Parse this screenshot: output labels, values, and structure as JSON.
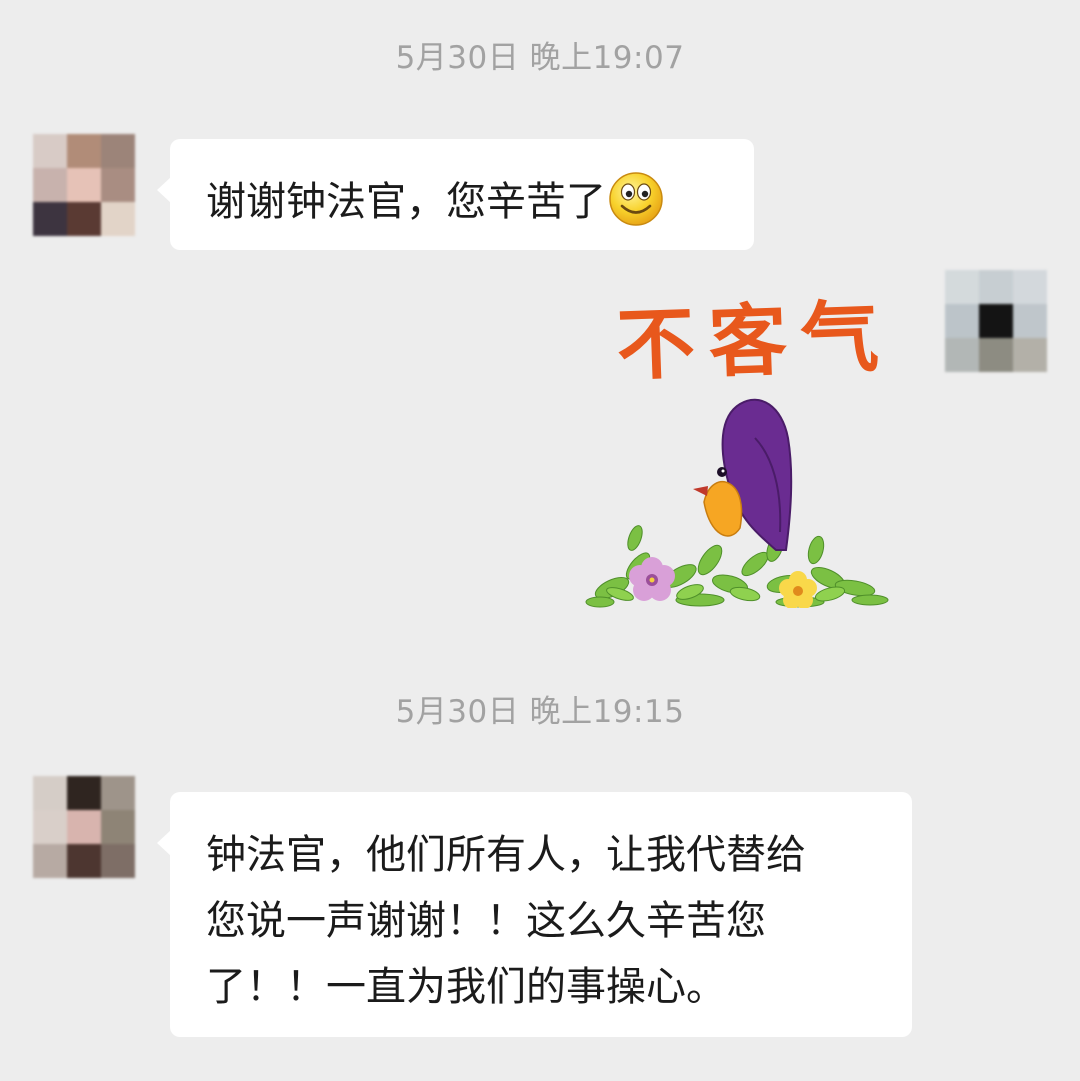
{
  "timestamps": [
    "5月30日 晚上19:07",
    "5月30日 晚上19:15"
  ],
  "messages": [
    {
      "sender": "contact",
      "text": "谢谢钟法官，您辛苦了",
      "trailing_emoji": "smile-emoji"
    },
    {
      "sender": "self",
      "sticker": {
        "text": "不客气",
        "icon": "parrot-on-flowers-sticker"
      }
    },
    {
      "sender": "contact",
      "text": "钟法官，他们所有人，让我代替给\n您说一声谢谢！！这么久辛苦您\n了！！一直为我们的事操心。"
    }
  ],
  "colors": {
    "background": "#ededed",
    "bubble": "#ffffff",
    "timestamp": "#a2a2a2",
    "sticker_text": "#e8581c",
    "parrot": "#6a2c91",
    "parrot_chest": "#f6a623"
  }
}
